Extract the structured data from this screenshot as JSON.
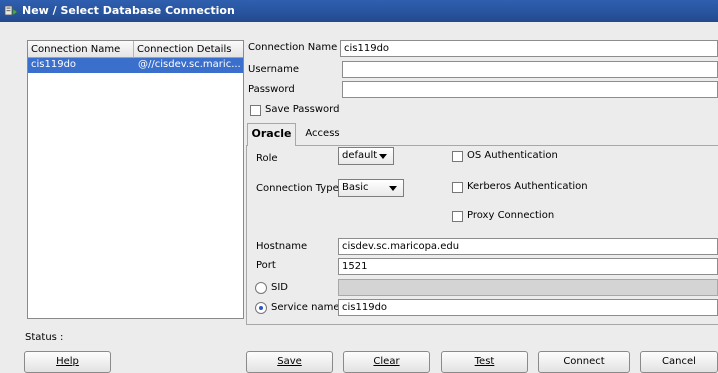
{
  "window": {
    "title": "New / Select Database Connection",
    "icon": "database-connection-icon"
  },
  "connections_table": {
    "columns": [
      "Connection Name",
      "Connection Details"
    ],
    "rows": [
      {
        "name": "cis119do",
        "details": "@//cisdev.sc.maric..."
      }
    ]
  },
  "form": {
    "connection_name": {
      "label": "Connection Name",
      "value": "cis119do"
    },
    "username": {
      "label": "Username",
      "value": ""
    },
    "password": {
      "label": "Password",
      "value": ""
    },
    "save_password": {
      "label": "Save Password",
      "checked": false
    }
  },
  "tabs": [
    {
      "label": "Oracle",
      "active": true
    },
    {
      "label": "Access",
      "active": false
    }
  ],
  "oracle": {
    "role": {
      "label": "Role",
      "value": "default"
    },
    "connection_type": {
      "label": "Connection Type",
      "value": "Basic"
    },
    "os_auth": {
      "label": "OS Authentication",
      "checked": false
    },
    "kerberos_auth": {
      "label": "Kerberos Authentication",
      "checked": false
    },
    "proxy_connection": {
      "label": "Proxy Connection",
      "checked": false
    },
    "hostname": {
      "label": "Hostname",
      "value": "cisdev.sc.maricopa.edu"
    },
    "port": {
      "label": "Port",
      "value": "1521"
    },
    "sid": {
      "label": "SID",
      "value": "",
      "selected": false
    },
    "service_name": {
      "label": "Service name",
      "value": "cis119do",
      "selected": true
    }
  },
  "status": {
    "label": "Status :"
  },
  "buttons": {
    "help": "Help",
    "save": "Save",
    "clear": "Clear",
    "test": "Test",
    "connect": "Connect",
    "cancel": "Cancel"
  }
}
